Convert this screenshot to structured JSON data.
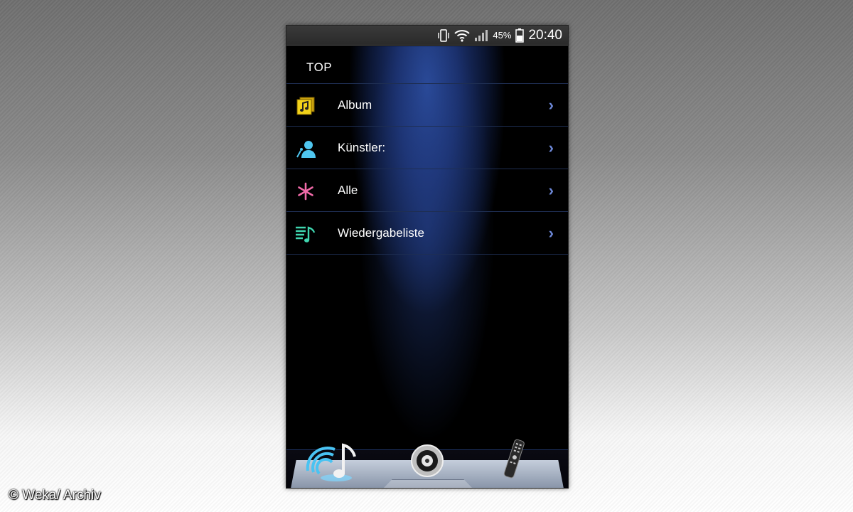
{
  "statusbar": {
    "battery_percent": "45%",
    "time": "20:40",
    "icons": [
      "vibrate-icon",
      "wifi-icon",
      "signal-icon",
      "battery-icon"
    ]
  },
  "header": {
    "title": "TOP"
  },
  "menu": {
    "items": [
      {
        "label": "Album",
        "icon": "album-icon",
        "icon_color": "#f2d21a"
      },
      {
        "label": "Künstler:",
        "icon": "artist-icon",
        "icon_color": "#4fc6ef"
      },
      {
        "label": "Alle",
        "icon": "all-asterisk-icon",
        "icon_color": "#f06aa8"
      },
      {
        "label": "Wiedergabeliste",
        "icon": "playlist-icon",
        "icon_color": "#3fd6b0"
      }
    ],
    "chevron": "›"
  },
  "dock": {
    "items": [
      "wireless-music-icon",
      "speaker-icon",
      "remote-control-icon"
    ]
  },
  "watermark": "© Weka/ Archiv",
  "colors": {
    "accent": "#6d88d8",
    "background_top": "#2a4a98"
  }
}
